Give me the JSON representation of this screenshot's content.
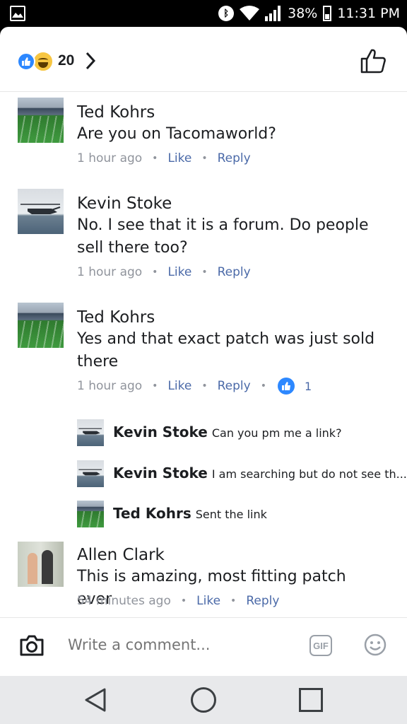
{
  "status_bar": {
    "battery": "38%",
    "time": "11:31 PM",
    "icons": [
      "gallery-icon",
      "bluetooth-icon",
      "wifi-icon",
      "signal-icon",
      "battery-icon"
    ]
  },
  "reactions": {
    "count": "20",
    "types": [
      "like-icon",
      "haha-icon"
    ]
  },
  "labels": {
    "like": "Like",
    "reply": "Reply"
  },
  "comments": [
    {
      "name": "Ted Kohrs",
      "text": "Are you on Tacomaworld?",
      "time": "1 hour ago"
    },
    {
      "name": "Kevin Stoke",
      "text": "No. I see that it is a forum. Do people sell there too?",
      "time": "1 hour ago"
    },
    {
      "name": "Ted Kohrs",
      "text": "Yes and that exact patch was just sold there",
      "time": "1 hour ago",
      "likes": "1"
    },
    {
      "name": "Allen Clark",
      "text": "This is amazing, most fitting patch ever",
      "time": "54 minutes ago"
    }
  ],
  "replies": [
    {
      "name": "Kevin Stoke",
      "text": "Can you pm me a link?"
    },
    {
      "name": "Kevin Stoke",
      "text": "I am searching but do not see th..."
    },
    {
      "name": "Ted Kohrs",
      "text": "Sent the link"
    }
  ],
  "composer": {
    "placeholder": "Write a comment...",
    "gif_label": "GIF"
  },
  "colors": {
    "link": "#4b6aa8",
    "like_blue": "#2d88ff",
    "meta_gray": "#90949c"
  }
}
